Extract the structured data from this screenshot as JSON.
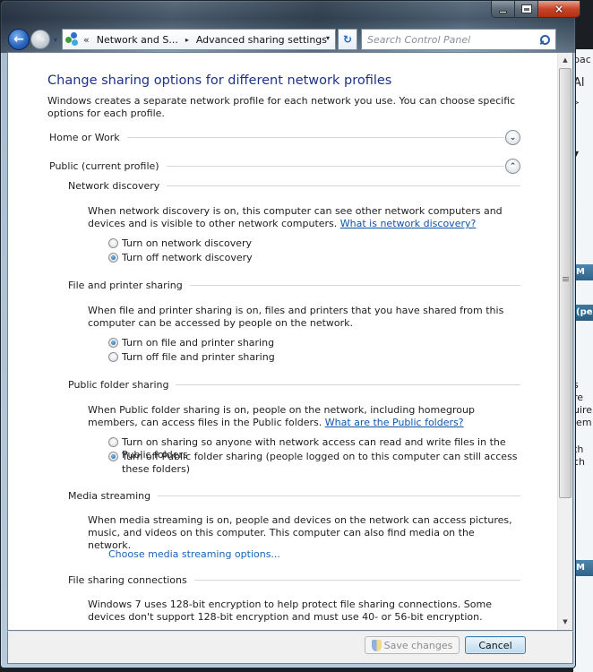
{
  "window": {
    "caption_buttons": {
      "minimize": "minimize-icon",
      "maximize": "maximize-icon",
      "close": "×"
    }
  },
  "navbar": {
    "back_icon": "←",
    "forward_icon": "→",
    "recent_icon": "▾",
    "address": {
      "overflow": "«",
      "crumbs": [
        "Network and S...",
        "Advanced sharing settings"
      ],
      "separator": "▸",
      "dropdown": "▾"
    },
    "refresh_icon": "↻",
    "search": {
      "placeholder": "Search Control Panel"
    }
  },
  "page": {
    "title": "Change sharing options for different network profiles",
    "intro": "Windows creates a separate network profile for each network you use. You can choose specific options for each profile.",
    "profiles": [
      {
        "label": "Home or Work",
        "expanded": false,
        "expander": "⌄"
      },
      {
        "label": "Public (current profile)",
        "expanded": true,
        "expander": "⌃"
      }
    ],
    "sections": {
      "network_discovery": {
        "heading": "Network discovery",
        "description": "When network discovery is on, this computer can see other network computers and devices and is visible to other network computers. ",
        "link": "What is network discovery?",
        "options": [
          {
            "label": "Turn on network discovery",
            "checked": false
          },
          {
            "label": "Turn off network discovery",
            "checked": true
          }
        ]
      },
      "file_printer": {
        "heading": "File and printer sharing",
        "description": "When file and printer sharing is on, files and printers that you have shared from this computer can be accessed by people on the network.",
        "options": [
          {
            "label": "Turn on file and printer sharing",
            "checked": true
          },
          {
            "label": "Turn off file and printer sharing",
            "checked": false
          }
        ]
      },
      "public_folder": {
        "heading": "Public folder sharing",
        "description": "When Public folder sharing is on, people on the network, including homegroup members, can access files in the Public folders. ",
        "link": "What are the Public folders?",
        "options": [
          {
            "label": "Turn on sharing so anyone with network access can read and write files in the Public folders",
            "checked": false
          },
          {
            "label": "Turn off Public folder sharing (people logged on to this computer can still access these folders)",
            "checked": true
          }
        ]
      },
      "media_streaming": {
        "heading": "Media streaming",
        "description": "When media streaming is on, people and devices on the network can access pictures, music, and videos on this computer. This computer can also find media on the network.",
        "link": "Choose media streaming options..."
      },
      "file_sharing_connections": {
        "heading": "File sharing connections",
        "description": "Windows 7 uses 128-bit encryption to help protect file sharing connections. Some devices don't support 128-bit encryption and must use 40- or 56-bit encryption."
      }
    }
  },
  "scrollbar": {
    "up": "▲",
    "down": "▼"
  },
  "footer": {
    "save_label": "Save changes",
    "save_enabled": false,
    "cancel_label": "Cancel"
  },
  "background_window": {
    "fragments": [
      "pac",
      "Al",
      ">",
      "▼",
      "M",
      "(pe",
      "s",
      "re",
      "uire",
      "lem",
      "th",
      "ch",
      "M"
    ]
  }
}
